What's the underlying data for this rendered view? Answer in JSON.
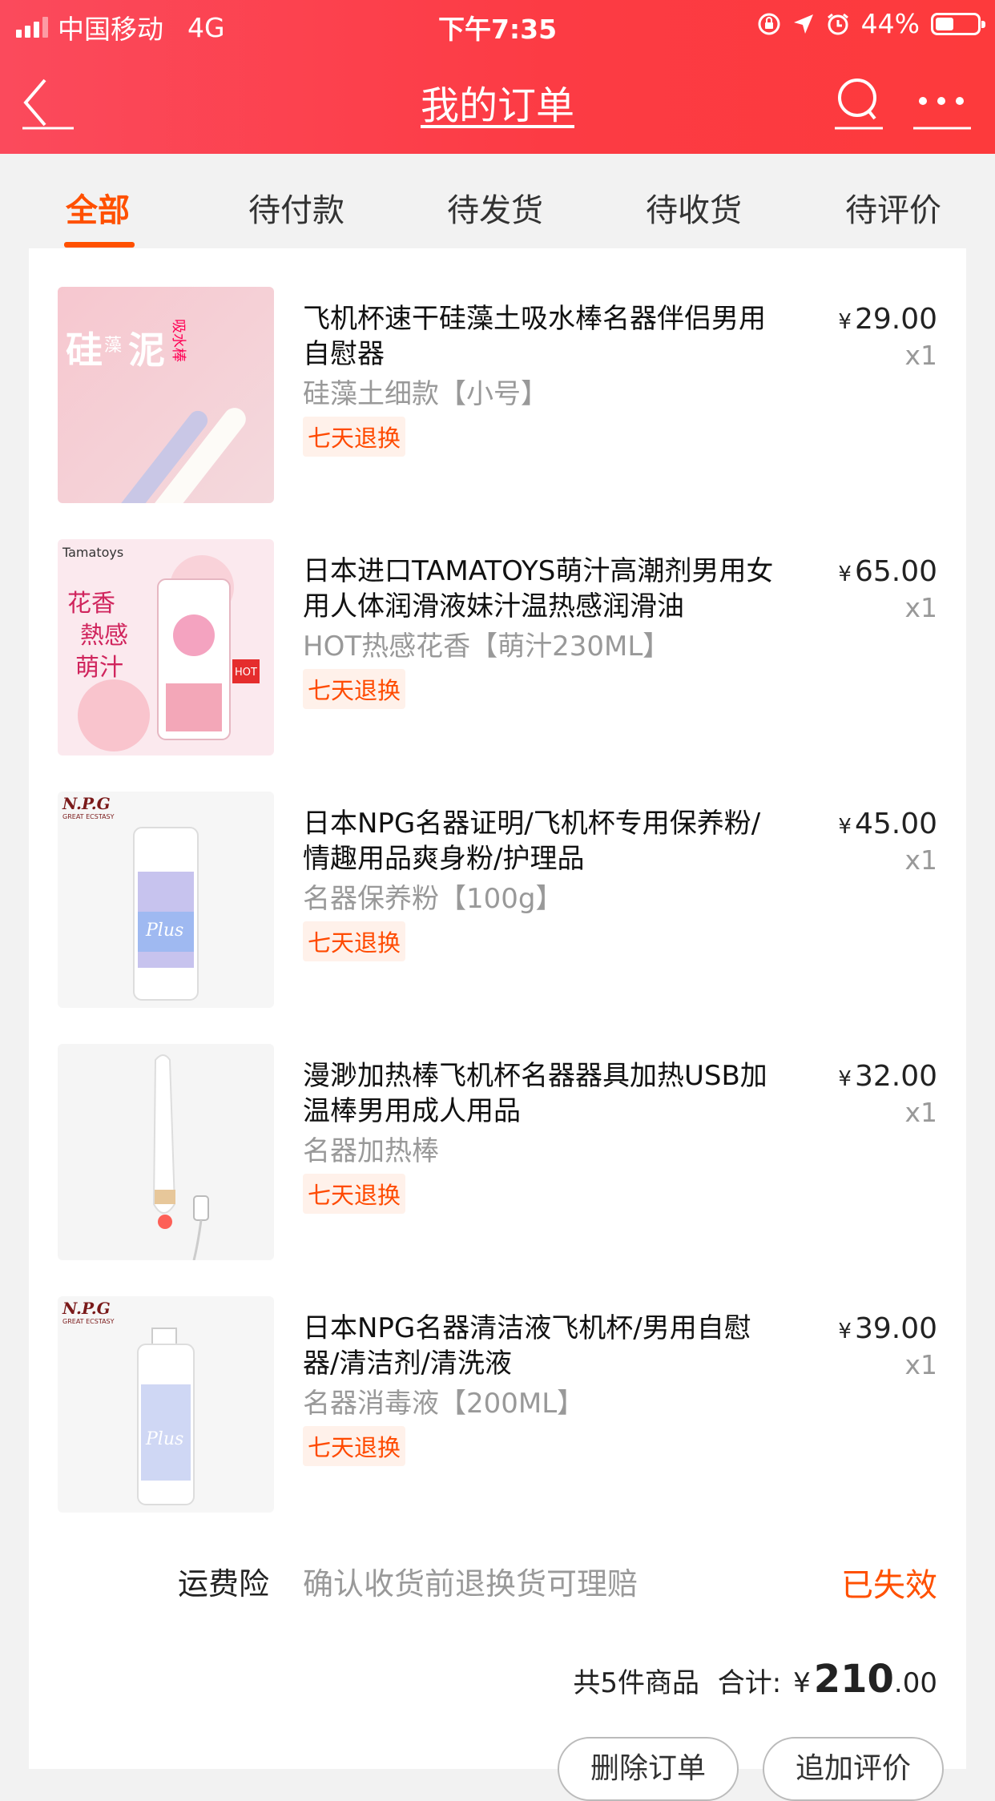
{
  "status_bar": {
    "carrier": "中国移动",
    "network": "4G",
    "time": "下午7:35",
    "battery": "44%",
    "battery_level": 0.44
  },
  "nav": {
    "title": "我的订单",
    "icons": [
      "back-arrow-icon",
      "search-icon",
      "more-icon"
    ]
  },
  "tabs": [
    {
      "label": "全部",
      "active": true
    },
    {
      "label": "待付款",
      "active": false
    },
    {
      "label": "待发货",
      "active": false
    },
    {
      "label": "待收货",
      "active": false
    },
    {
      "label": "待评价",
      "active": false
    }
  ],
  "items": [
    {
      "title": "飞机杯速干硅藻土吸水棒名器伴侣男用自慰器",
      "sku": "硅藻土细款【小号】",
      "tag": "七天退换",
      "price_symbol": "¥",
      "price": "29.00",
      "qty": "x1",
      "thumb_text": [
        "硅",
        "藻",
        "泥",
        "吸水棒"
      ]
    },
    {
      "title": "日本进口TAMATOYS萌汁高潮剂男用女用人体润滑液妹汁温热感润滑油",
      "sku": "HOT热感花香【萌汁230ML】",
      "tag": "七天退换",
      "price_symbol": "¥",
      "price": "65.00",
      "qty": "x1",
      "thumb_text": [
        "Tamatoys",
        "花香",
        "熱感",
        "萌汁",
        "HOT"
      ]
    },
    {
      "title": "日本NPG名器证明/飞机杯专用保养粉/情趣用品爽身粉/护理品",
      "sku": "名器保养粉【100g】",
      "tag": "七天退换",
      "price_symbol": "¥",
      "price": "45.00",
      "qty": "x1",
      "thumb_text": [
        "N.P.G",
        "GREAT ECSTASY",
        "Plus"
      ]
    },
    {
      "title": "漫渺加热棒飞机杯名器器具加热USB加温棒男用成人用品",
      "sku": "名器加热棒",
      "tag": "七天退换",
      "price_symbol": "¥",
      "price": "32.00",
      "qty": "x1",
      "thumb_text": []
    },
    {
      "title": "日本NPG名器清洁液飞机杯/男用自慰器/清洁剂/清洗液",
      "sku": "名器消毒液【200ML】",
      "tag": "七天退换",
      "price_symbol": "¥",
      "price": "39.00",
      "qty": "x1",
      "thumb_text": [
        "N.P.G",
        "GREAT ECSTASY",
        "Plus"
      ]
    }
  ],
  "insurance": {
    "label": "运费险",
    "desc": "确认收货前退换货可理赔",
    "status": "已失效"
  },
  "summary": {
    "count_text": "共5件商品",
    "total_label": "合计:",
    "currency": "¥",
    "total_int": "210",
    "total_dec": ".00"
  },
  "actions": {
    "delete": "删除订单",
    "review": "追加评价"
  },
  "colors": {
    "header_start": "#fb4a5c",
    "header_end": "#fd3a3c",
    "accent": "#ff5000",
    "page_bg": "#f2f2f2"
  }
}
